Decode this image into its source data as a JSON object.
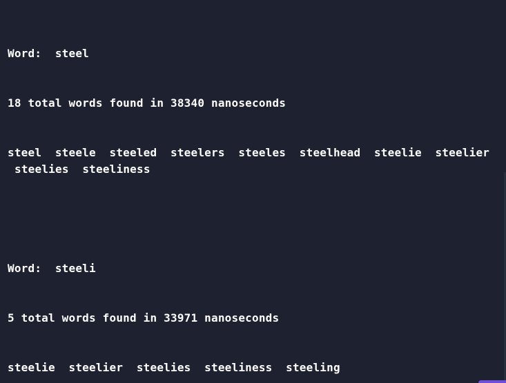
{
  "blocks": [
    {
      "word_line": "Word:  steel",
      "summary_line": "18 total words found in 38340 nanoseconds",
      "results_line_1": "steel  steele  steeled  steelers  steeles  steelhead  steelie  steelier",
      "results_line_2": "steelies  steeliness"
    },
    {
      "word_line": "Word:  steeli",
      "summary_line": "5 total words found in 33971 nanoseconds",
      "results_line_1": "steelie  steelier  steelies  steeliness  steeling"
    }
  ],
  "colors": {
    "background": "#1e2230",
    "text": "#ffffff",
    "accent": "#6f4fd8"
  }
}
